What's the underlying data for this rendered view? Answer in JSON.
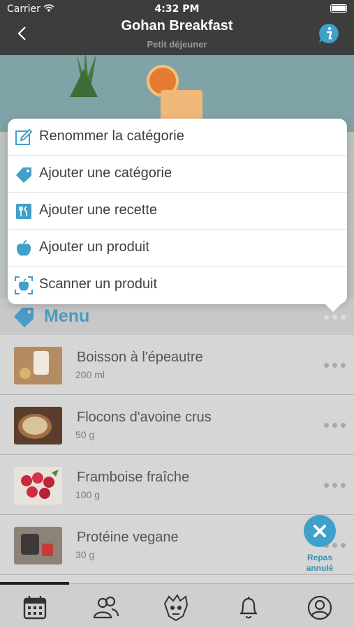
{
  "status_bar": {
    "carrier": "Carrier",
    "time": "4:32 PM"
  },
  "header": {
    "title": "Gohan Breakfast",
    "subtitle": "Petit déjeuner"
  },
  "section": {
    "title": "Menu"
  },
  "items": [
    {
      "name": "Boisson à l'épeautre",
      "qty": "200 ml"
    },
    {
      "name": "Flocons d'avoine crus",
      "qty": "50 g"
    },
    {
      "name": "Framboise fraîche",
      "qty": "100 g"
    },
    {
      "name": "Protéine vegane",
      "qty": "30 g"
    }
  ],
  "fab": {
    "label_line1": "Repas",
    "label_line2": "annulé"
  },
  "popup_menu": [
    {
      "label": "Renommer la catégorie",
      "icon": "edit-icon"
    },
    {
      "label": "Ajouter une catégorie",
      "icon": "tag-icon"
    },
    {
      "label": "Ajouter une recette",
      "icon": "recipe-icon"
    },
    {
      "label": "Ajouter un produit",
      "icon": "apple-icon"
    },
    {
      "label": "Scanner un produit",
      "icon": "scan-apple-icon"
    }
  ],
  "tabs": [
    {
      "name": "calendar-tab",
      "icon": "calendar-icon"
    },
    {
      "name": "community-tab",
      "icon": "people-icon"
    },
    {
      "name": "mascot-tab",
      "icon": "mascot-icon"
    },
    {
      "name": "notifications-tab",
      "icon": "bell-icon"
    },
    {
      "name": "profile-tab",
      "icon": "user-icon"
    }
  ],
  "colors": {
    "accent": "#3fa0c9",
    "navbar": "#3d3d3d"
  }
}
